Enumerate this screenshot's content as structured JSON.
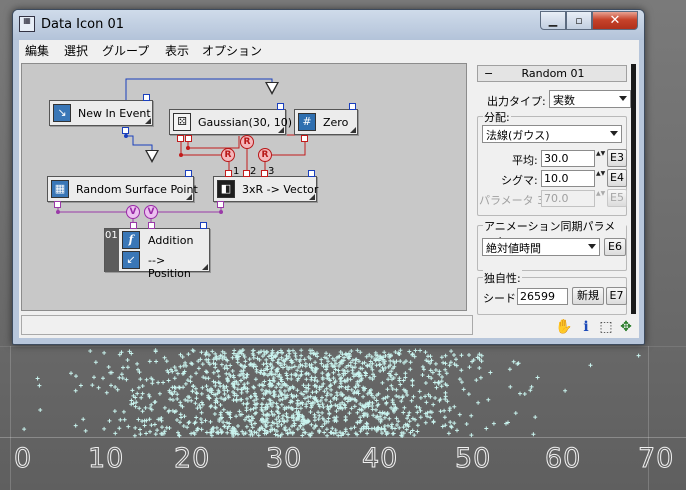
{
  "window": {
    "title": "Data Icon 01",
    "app_icon": "grid-app-icon"
  },
  "caption_buttons": {
    "minimize": "▁",
    "maximize": "▫",
    "close": "✕"
  },
  "menu": [
    "編集",
    "選択",
    "グループ",
    "表示",
    "オプション"
  ],
  "nodes": {
    "new_in_event": "New In Event",
    "gaussian": "Gaussian(30, 10)",
    "zero": "Zero",
    "random_surface_point": "Random Surface Point",
    "vector3": "3xR -> Vector",
    "addition_badge": "01",
    "addition": "Addition",
    "position": "--> Position",
    "op_r": "R",
    "op_v": "V",
    "pin_1": "1",
    "pin_2": "2",
    "pin_3": "3"
  },
  "panel": {
    "rollout_collapse": "−",
    "rollout_title": "Random 01",
    "output_type_label": "出力タイプ:",
    "output_type_value": "実数",
    "distribution_group": "分配:",
    "distribution_value": "法線(ガウス)",
    "mean_label": "平均:",
    "mean_value": "30.0",
    "mean_button": "E3",
    "sigma_label": "シグマ:",
    "sigma_value": "10.0",
    "sigma_button": "E4",
    "param3_label": "パラメータ 3:",
    "param3_value": "70.0",
    "param3_button": "E5",
    "anim_sync_group": "アニメーション同期パラメータ:",
    "anim_sync_value": "絶対値時間",
    "anim_sync_button": "E6",
    "uniqueness_group": "独自性:",
    "seed_label": "シード:",
    "seed_value": "26599",
    "new_button": "新規",
    "new_button_id": "E7",
    "spinner_glyphs": "▲▼"
  },
  "status_icons": [
    "hand-pan-icon",
    "info-icon",
    "zoom-region-icon",
    "navigate-icon"
  ],
  "status_glyphs": {
    "pan": "✋",
    "info": "i",
    "zoom": "⬚",
    "nav": "✥"
  },
  "axis": {
    "ticks": [
      "0",
      "10",
      "20",
      "30",
      "40",
      "50",
      "60",
      "70"
    ]
  },
  "colors": {
    "particle": "#c9f3ee",
    "wire_blue": "#1a3fbd",
    "wire_red": "#c21b1b",
    "wire_purple": "#9a3aa8"
  },
  "particle_distribution": {
    "type": "gaussian",
    "mean": 30,
    "sigma": 10
  }
}
